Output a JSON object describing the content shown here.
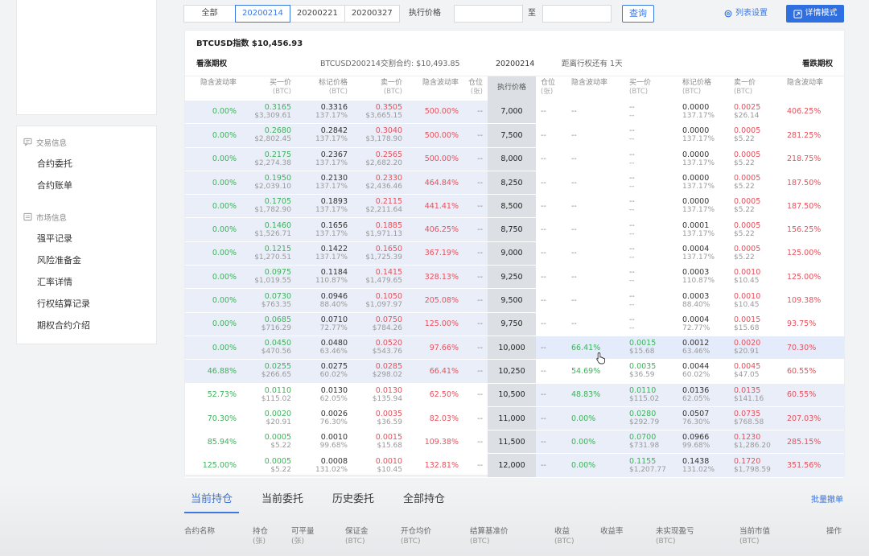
{
  "sidebar": {
    "groups": [
      {
        "label": "交易信息",
        "items": [
          "合约委托",
          "合约账单"
        ]
      },
      {
        "label": "市场信息",
        "items": [
          "强平记录",
          "风险准备金",
          "汇率详情",
          "行权结算记录",
          "期权合约介绍"
        ]
      }
    ]
  },
  "filter": {
    "tabs": [
      "全部",
      "20200214",
      "20200221",
      "20200327"
    ],
    "active_tab": "20200214",
    "strike_label": "执行价格",
    "to_label": "至",
    "query_label": "查询",
    "column_settings_label": "列表设置",
    "detail_mode_label": "详情模式"
  },
  "board": {
    "index_text": "BTCUSD指数 $10,456.93",
    "call_label": "看涨期权",
    "contract_text": "BTCUSD200214交割合约: $10,493.85",
    "expiry": "20200214",
    "remaining": "距离行权还有 1天",
    "put_label": "看跌期权"
  },
  "columns": {
    "call": [
      {
        "label": "隐含波动率",
        "unit": ""
      },
      {
        "label": "买一价",
        "unit": "(BTC)"
      },
      {
        "label": "标记价格",
        "unit": "(BTC)"
      },
      {
        "label": "卖一价",
        "unit": "(BTC)"
      },
      {
        "label": "隐含波动率",
        "unit": ""
      },
      {
        "label": "仓位",
        "unit": "(张)"
      }
    ],
    "strike": "执行价格",
    "put": [
      {
        "label": "仓位",
        "unit": "(张)"
      },
      {
        "label": "隐含波动率",
        "unit": ""
      },
      {
        "label": "买一价",
        "unit": "(BTC)"
      },
      {
        "label": "标记价格",
        "unit": "(BTC)"
      },
      {
        "label": "卖一价",
        "unit": "(BTC)"
      },
      {
        "label": "隐含波动率",
        "unit": ""
      }
    ]
  },
  "rows": [
    {
      "strike": "7,000",
      "c_biv": "0.00%",
      "c_bid": "0.3165",
      "c_bid_usd": "$3,309.61",
      "c_mark": "0.3316",
      "c_mark_iv": "137.17%",
      "c_ask": "0.3505",
      "c_ask_usd": "$3,665.15",
      "c_aiv": "500.00%",
      "c_pos": "--",
      "p_pos": "--",
      "p_biv": "--",
      "p_bid": "--",
      "p_bid_usd": "--",
      "p_mark": "0.0000",
      "p_mark_iv": "137.17%",
      "p_ask": "0.0025",
      "p_ask_usd": "$26.14",
      "p_aiv": "406.25%"
    },
    {
      "strike": "7,500",
      "c_biv": "0.00%",
      "c_bid": "0.2680",
      "c_bid_usd": "$2,802.45",
      "c_mark": "0.2842",
      "c_mark_iv": "137.17%",
      "c_ask": "0.3040",
      "c_ask_usd": "$3,178.90",
      "c_aiv": "500.00%",
      "c_pos": "--",
      "p_pos": "--",
      "p_biv": "--",
      "p_bid": "--",
      "p_bid_usd": "--",
      "p_mark": "0.0000",
      "p_mark_iv": "137.17%",
      "p_ask": "0.0005",
      "p_ask_usd": "$5.22",
      "p_aiv": "281.25%"
    },
    {
      "strike": "8,000",
      "c_biv": "0.00%",
      "c_bid": "0.2175",
      "c_bid_usd": "$2,274.38",
      "c_mark": "0.2367",
      "c_mark_iv": "137.17%",
      "c_ask": "0.2565",
      "c_ask_usd": "$2,682.20",
      "c_aiv": "500.00%",
      "c_pos": "--",
      "p_pos": "--",
      "p_biv": "--",
      "p_bid": "--",
      "p_bid_usd": "--",
      "p_mark": "0.0000",
      "p_mark_iv": "137.17%",
      "p_ask": "0.0005",
      "p_ask_usd": "$5.22",
      "p_aiv": "218.75%"
    },
    {
      "strike": "8,250",
      "c_biv": "0.00%",
      "c_bid": "0.1950",
      "c_bid_usd": "$2,039.10",
      "c_mark": "0.2130",
      "c_mark_iv": "137.17%",
      "c_ask": "0.2330",
      "c_ask_usd": "$2,436.46",
      "c_aiv": "464.84%",
      "c_pos": "--",
      "p_pos": "--",
      "p_biv": "--",
      "p_bid": "--",
      "p_bid_usd": "--",
      "p_mark": "0.0000",
      "p_mark_iv": "137.17%",
      "p_ask": "0.0005",
      "p_ask_usd": "$5.22",
      "p_aiv": "187.50%"
    },
    {
      "strike": "8,500",
      "c_biv": "0.00%",
      "c_bid": "0.1705",
      "c_bid_usd": "$1,782.90",
      "c_mark": "0.1893",
      "c_mark_iv": "137.17%",
      "c_ask": "0.2115",
      "c_ask_usd": "$2,211.64",
      "c_aiv": "441.41%",
      "c_pos": "--",
      "p_pos": "--",
      "p_biv": "--",
      "p_bid": "--",
      "p_bid_usd": "--",
      "p_mark": "0.0000",
      "p_mark_iv": "137.17%",
      "p_ask": "0.0005",
      "p_ask_usd": "$5.22",
      "p_aiv": "187.50%"
    },
    {
      "strike": "8,750",
      "c_biv": "0.00%",
      "c_bid": "0.1460",
      "c_bid_usd": "$1,526.71",
      "c_mark": "0.1656",
      "c_mark_iv": "137.17%",
      "c_ask": "0.1885",
      "c_ask_usd": "$1,971.13",
      "c_aiv": "406.25%",
      "c_pos": "--",
      "p_pos": "--",
      "p_biv": "--",
      "p_bid": "--",
      "p_bid_usd": "--",
      "p_mark": "0.0001",
      "p_mark_iv": "137.17%",
      "p_ask": "0.0005",
      "p_ask_usd": "$5.22",
      "p_aiv": "156.25%"
    },
    {
      "strike": "9,000",
      "c_biv": "0.00%",
      "c_bid": "0.1215",
      "c_bid_usd": "$1,270.51",
      "c_mark": "0.1422",
      "c_mark_iv": "137.17%",
      "c_ask": "0.1650",
      "c_ask_usd": "$1,725.39",
      "c_aiv": "367.19%",
      "c_pos": "--",
      "p_pos": "--",
      "p_biv": "--",
      "p_bid": "--",
      "p_bid_usd": "--",
      "p_mark": "0.0004",
      "p_mark_iv": "137.17%",
      "p_ask": "0.0005",
      "p_ask_usd": "$5.22",
      "p_aiv": "125.00%"
    },
    {
      "strike": "9,250",
      "c_biv": "0.00%",
      "c_bid": "0.0975",
      "c_bid_usd": "$1,019.55",
      "c_mark": "0.1184",
      "c_mark_iv": "110.87%",
      "c_ask": "0.1415",
      "c_ask_usd": "$1,479.65",
      "c_aiv": "328.13%",
      "c_pos": "--",
      "p_pos": "--",
      "p_biv": "--",
      "p_bid": "--",
      "p_bid_usd": "--",
      "p_mark": "0.0003",
      "p_mark_iv": "110.87%",
      "p_ask": "0.0010",
      "p_ask_usd": "$10.45",
      "p_aiv": "125.00%"
    },
    {
      "strike": "9,500",
      "c_biv": "0.00%",
      "c_bid": "0.0730",
      "c_bid_usd": "$763.35",
      "c_mark": "0.0946",
      "c_mark_iv": "88.40%",
      "c_ask": "0.1050",
      "c_ask_usd": "$1,097.97",
      "c_aiv": "205.08%",
      "c_pos": "--",
      "p_pos": "--",
      "p_biv": "--",
      "p_bid": "--",
      "p_bid_usd": "--",
      "p_mark": "0.0003",
      "p_mark_iv": "88.40%",
      "p_ask": "0.0010",
      "p_ask_usd": "$10.45",
      "p_aiv": "109.38%"
    },
    {
      "strike": "9,750",
      "c_biv": "0.00%",
      "c_bid": "0.0685",
      "c_bid_usd": "$716.29",
      "c_mark": "0.0710",
      "c_mark_iv": "72.77%",
      "c_ask": "0.0750",
      "c_ask_usd": "$784.26",
      "c_aiv": "125.00%",
      "c_pos": "--",
      "p_pos": "--",
      "p_biv": "--",
      "p_bid": "--",
      "p_bid_usd": "--",
      "p_mark": "0.0004",
      "p_mark_iv": "72.77%",
      "p_ask": "0.0015",
      "p_ask_usd": "$15.68",
      "p_aiv": "93.75%"
    },
    {
      "strike": "10,000",
      "c_biv": "0.00%",
      "c_bid": "0.0450",
      "c_bid_usd": "$470.56",
      "c_mark": "0.0480",
      "c_mark_iv": "63.46%",
      "c_ask": "0.0520",
      "c_ask_usd": "$543.76",
      "c_aiv": "97.66%",
      "c_pos": "--",
      "p_pos": "--",
      "p_biv": "66.41%",
      "p_bid": "0.0015",
      "p_bid_usd": "$15.68",
      "p_mark": "0.0012",
      "p_mark_iv": "63.46%",
      "p_ask": "0.0020",
      "p_ask_usd": "$20.91",
      "p_aiv": "70.30%"
    },
    {
      "strike": "10,250",
      "c_biv": "46.88%",
      "c_bid": "0.0255",
      "c_bid_usd": "$266.65",
      "c_mark": "0.0275",
      "c_mark_iv": "60.02%",
      "c_ask": "0.0285",
      "c_ask_usd": "$298.02",
      "c_aiv": "66.41%",
      "c_pos": "--",
      "p_pos": "--",
      "p_biv": "54.69%",
      "p_bid": "0.0035",
      "p_bid_usd": "$36.59",
      "p_mark": "0.0044",
      "p_mark_iv": "60.02%",
      "p_ask": "0.0045",
      "p_ask_usd": "$47.05",
      "p_aiv": "60.55%"
    },
    {
      "strike": "10,500",
      "c_biv": "52.73%",
      "c_bid": "0.0110",
      "c_bid_usd": "$115.02",
      "c_mark": "0.0130",
      "c_mark_iv": "62.05%",
      "c_ask": "0.0130",
      "c_ask_usd": "$135.94",
      "c_aiv": "62.50%",
      "c_pos": "--",
      "p_pos": "--",
      "p_biv": "48.83%",
      "p_bid": "0.0110",
      "p_bid_usd": "$115.02",
      "p_mark": "0.0136",
      "p_mark_iv": "62.05%",
      "p_ask": "0.0135",
      "p_ask_usd": "$141.16",
      "p_aiv": "60.55%"
    },
    {
      "strike": "11,000",
      "c_biv": "70.30%",
      "c_bid": "0.0020",
      "c_bid_usd": "$20.91",
      "c_mark": "0.0026",
      "c_mark_iv": "76.30%",
      "c_ask": "0.0035",
      "c_ask_usd": "$36.59",
      "c_aiv": "82.03%",
      "c_pos": "--",
      "p_pos": "--",
      "p_biv": "0.00%",
      "p_bid": "0.0280",
      "p_bid_usd": "$292.79",
      "p_mark": "0.0507",
      "p_mark_iv": "76.30%",
      "p_ask": "0.0735",
      "p_ask_usd": "$768.58",
      "p_aiv": "207.03%"
    },
    {
      "strike": "11,500",
      "c_biv": "85.94%",
      "c_bid": "0.0005",
      "c_bid_usd": "$5.22",
      "c_mark": "0.0010",
      "c_mark_iv": "99.68%",
      "c_ask": "0.0015",
      "c_ask_usd": "$15.68",
      "c_aiv": "109.38%",
      "c_pos": "--",
      "p_pos": "--",
      "p_biv": "0.00%",
      "p_bid": "0.0700",
      "p_bid_usd": "$731.98",
      "p_mark": "0.0966",
      "p_mark_iv": "99.68%",
      "p_ask": "0.1230",
      "p_ask_usd": "$1,286.20",
      "p_aiv": "285.15%"
    },
    {
      "strike": "12,000",
      "c_biv": "125.00%",
      "c_bid": "0.0005",
      "c_bid_usd": "$5.22",
      "c_mark": "0.0008",
      "c_mark_iv": "131.02%",
      "c_ask": "0.0010",
      "c_ask_usd": "$10.45",
      "c_aiv": "132.81%",
      "c_pos": "--",
      "p_pos": "--",
      "p_biv": "0.00%",
      "p_bid": "0.1155",
      "p_bid_usd": "$1,207.77",
      "p_mark": "0.1438",
      "p_mark_iv": "131.02%",
      "p_ask": "0.1720",
      "p_ask_usd": "$1,798.59",
      "p_aiv": "351.56%"
    }
  ],
  "bottom": {
    "tabs": [
      "当前持仓",
      "当前委托",
      "历史委托",
      "全部持仓"
    ],
    "active_tab": "当前持仓",
    "batch_cancel": "批量撤单",
    "headers": [
      {
        "label": "合约名称",
        "unit": ""
      },
      {
        "label": "持仓",
        "unit": "(张)"
      },
      {
        "label": "可平量",
        "unit": "(张)"
      },
      {
        "label": "保证金",
        "unit": "(BTC)"
      },
      {
        "label": "开仓均价",
        "unit": "(BTC)"
      },
      {
        "label": "结算基准价",
        "unit": "(BTC)"
      },
      {
        "label": "收益",
        "unit": "(BTC)"
      },
      {
        "label": "收益率",
        "unit": ""
      },
      {
        "label": "未实现盈亏",
        "unit": "(BTC)"
      },
      {
        "label": "当前市值",
        "unit": "(BTC)"
      },
      {
        "label": "操作",
        "unit": ""
      }
    ]
  },
  "colors": {
    "accent": "#2f6fe0",
    "positive": "#3cb35a",
    "negative": "#e8505b",
    "itm_background": "#e9eef8",
    "strike_background": "#dcdfe3"
  }
}
